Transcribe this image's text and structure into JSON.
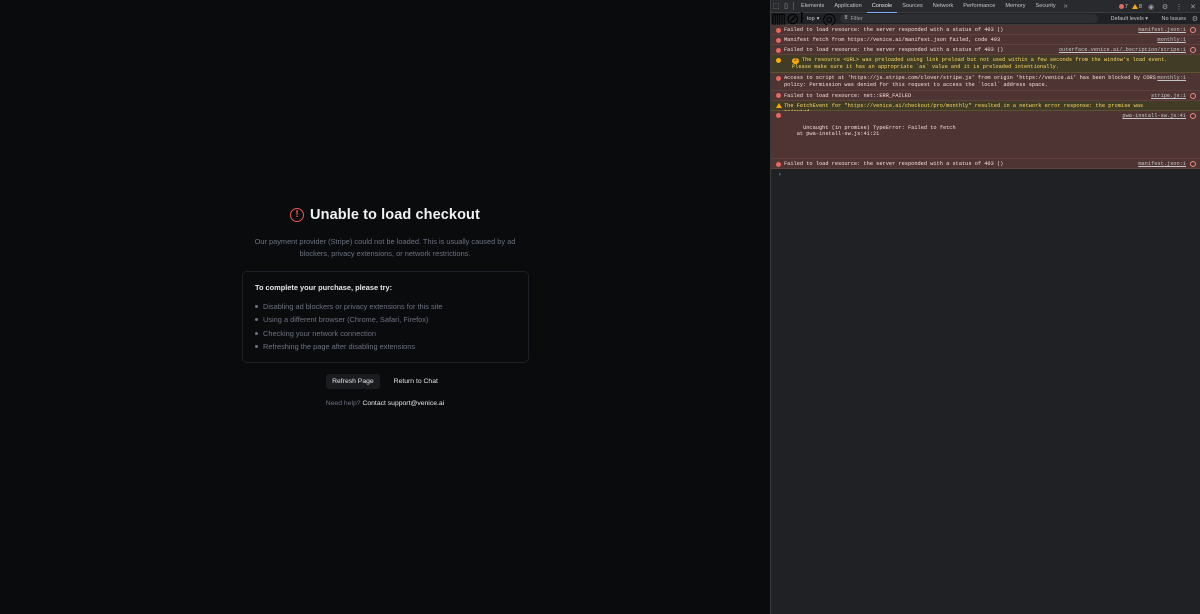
{
  "checkout": {
    "title": "Unable to load checkout",
    "subtitle": "Our payment provider (Stripe) could not be loaded. This is usually caused by ad blockers, privacy extensions, or network restrictions.",
    "tips_title": "To complete your purchase, please try:",
    "tips": [
      "Disabling ad blockers or privacy extensions for this site",
      "Using a different browser (Chrome, Safari, Firefox)",
      "Checking your network connection",
      "Refreshing the page after disabling extensions"
    ],
    "refresh_label": "Refresh Page",
    "return_label": "Return to Chat",
    "help_prefix": "Need help?",
    "help_link": "Contact support@venice.ai"
  },
  "devtools": {
    "tabs": [
      "Elements",
      "Application",
      "Console",
      "Sources",
      "Network",
      "Performance",
      "Memory",
      "Security"
    ],
    "active_tab": "Console",
    "error_count": "7",
    "warning_count": "8",
    "context": "top",
    "filter_placeholder": "Filter",
    "levels": "Default levels",
    "issues": "No Issues",
    "messages": [
      {
        "type": "error",
        "text": "Failed to load resource: the server responded with a status of 403 ()",
        "source": "manifest.json:1"
      },
      {
        "type": "error",
        "text": "Manifest fetch from https://venice.ai/manifest.json failed, code 403",
        "source": "monthly:1"
      },
      {
        "type": "error",
        "text": "Failed to load resource: the server responded with a status of 403 ()",
        "source": "outerface.venice.ai/…bscription/stripe:1"
      },
      {
        "type": "warn",
        "badge": "2",
        "text": "The resource <URL> was preloaded using link preload but not used within a few seconds from the window's load event. Please make sure it has an appropriate `as` value and it is preloaded intentionally.",
        "source": ""
      },
      {
        "type": "error",
        "text": "Access to script at 'https://js.stripe.com/clover/stripe.js' from origin 'https://venice.ai' has been blocked by CORS policy: Permission was denied for this request to access the `local` address space.",
        "source": "monthly:1"
      },
      {
        "type": "error",
        "text": "Failed to load resource: net::ERR_FAILED",
        "source": "stripe.js:1"
      },
      {
        "type": "warn",
        "text": "The FetchEvent for \"https://venice.ai/checkout/pro/monthly\" resulted in a network error response: the promise was rejected.",
        "source": ""
      },
      {
        "type": "error",
        "text": "Uncaught (in promise) TypeError: Failed to fetch\n    at pwa-install-sw.js:41:21",
        "source": "pwa-install-sw.js:41"
      },
      {
        "type": "error",
        "text": "Failed to load resource: the server responded with a status of 403 ()",
        "source": "manifest.json:1"
      }
    ]
  }
}
